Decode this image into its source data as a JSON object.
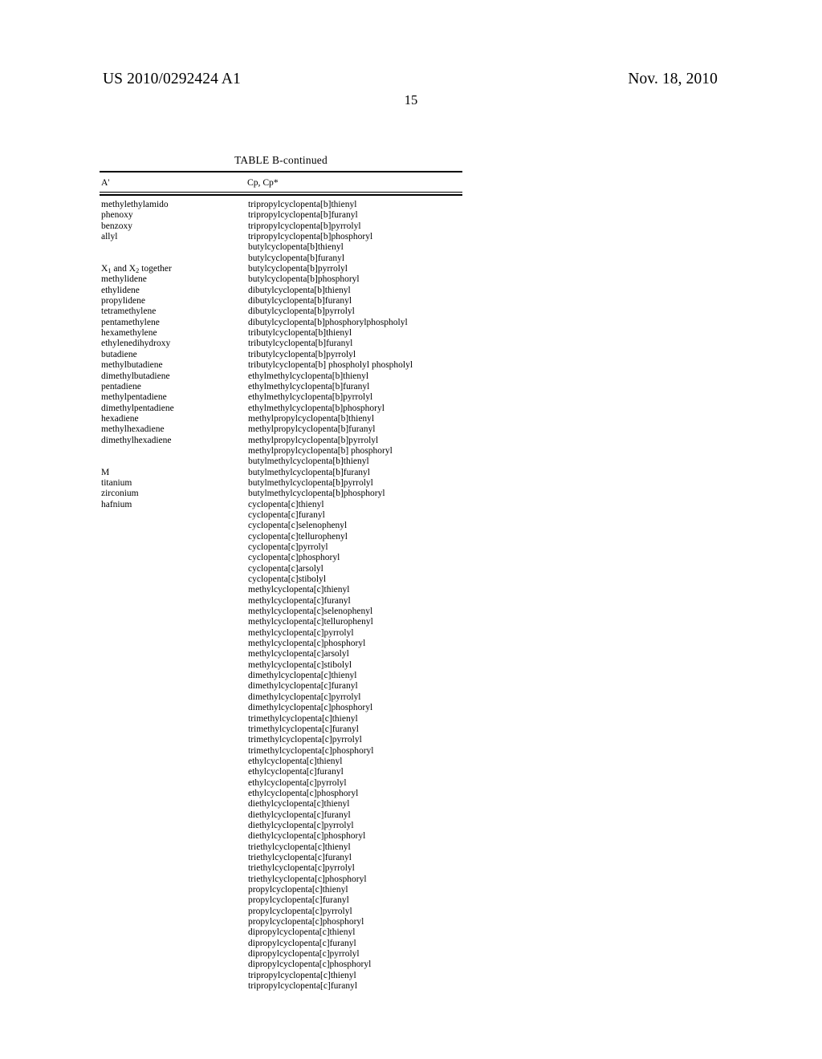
{
  "header": {
    "publication_number": "US 2010/0292424 A1",
    "publication_date": "Nov. 18, 2010",
    "page_number": "15"
  },
  "table": {
    "caption": "TABLE B-continued",
    "columns": [
      "A'",
      "Cp, Cp*"
    ],
    "rows": [
      [
        "methylethylamido",
        "tripropylcyclopenta[b]thienyl"
      ],
      [
        "phenoxy",
        "tripropylcyclopenta[b]furanyl"
      ],
      [
        "benzoxy",
        "tripropylcyclopenta[b]pyrrolyl"
      ],
      [
        "allyl",
        "tripropylcyclopenta[b]phosphoryl"
      ],
      [
        "",
        "butylcyclopenta[b]thienyl"
      ],
      [
        "",
        "butylcyclopenta[b]furanyl"
      ],
      [
        "X and X together",
        "butylcyclopenta[b]pyrrolyl"
      ],
      [
        "methylidene",
        "butylcyclopenta[b]phosphoryl"
      ],
      [
        "ethylidene",
        "dibutylcyclopenta[b]thienyl"
      ],
      [
        "propylidene",
        "dibutylcyclopenta[b]furanyl"
      ],
      [
        "tetramethylene",
        "dibutylcyclopenta[b]pyrrolyl"
      ],
      [
        "pentamethylene",
        "dibutylcyclopenta[b]phosphorylphospholyl"
      ],
      [
        "hexamethylene",
        "tributylcyclopenta[b]thienyl"
      ],
      [
        "ethylenedihydroxy",
        "tributylcyclopenta[b]furanyl"
      ],
      [
        "butadiene",
        "tributylcyclopenta[b]pyrrolyl"
      ],
      [
        "methylbutadiene",
        "tributylcyclopenta[b] phospholyl phospholyl"
      ],
      [
        "dimethylbutadiene",
        "ethylmethylcyclopenta[b]thienyl"
      ],
      [
        "pentadiene",
        "ethylmethylcyclopenta[b]furanyl"
      ],
      [
        "methylpentadiene",
        "ethylmethylcyclopenta[b]pyrrolyl"
      ],
      [
        "dimethylpentadiene",
        "ethylmethylcyclopenta[b]phosphoryl"
      ],
      [
        "hexadiene",
        "methylpropylcyclopenta[b]thienyl"
      ],
      [
        "methylhexadiene",
        "methylpropylcyclopenta[b]furanyl"
      ],
      [
        "dimethylhexadiene",
        "methylpropylcyclopenta[b]pyrrolyl"
      ],
      [
        "",
        "methylpropylcyclopenta[b] phosphoryl"
      ],
      [
        "",
        "butylmethylcyclopenta[b]thienyl"
      ],
      [
        "M",
        "butylmethylcyclopenta[b]furanyl"
      ],
      [
        "titanium",
        "butylmethylcyclopenta[b]pyrrolyl"
      ],
      [
        "zirconium",
        "butylmethylcyclopenta[b]phosphoryl"
      ],
      [
        "hafnium",
        "cyclopenta[c]thienyl"
      ],
      [
        "",
        "cyclopenta[c]furanyl"
      ],
      [
        "",
        "cyclopenta[c]selenophenyl"
      ],
      [
        "",
        "cyclopenta[c]tellurophenyl"
      ],
      [
        "",
        "cyclopenta[c]pyrrolyl"
      ],
      [
        "",
        "cyclopenta[c]phosphoryl"
      ],
      [
        "",
        "cyclopenta[c]arsolyl"
      ],
      [
        "",
        "cyclopenta[c]stibolyl"
      ],
      [
        "",
        "methylcyclopenta[c]thienyl"
      ],
      [
        "",
        "methylcyclopenta[c]furanyl"
      ],
      [
        "",
        "methylcyclopenta[c]selenophenyl"
      ],
      [
        "",
        "methylcyclopenta[c]tellurophenyl"
      ],
      [
        "",
        "methylcyclopenta[c]pyrrolyl"
      ],
      [
        "",
        "methylcyclopenta[c]phosphoryl"
      ],
      [
        "",
        "methylcyclopenta[c]arsolyl"
      ],
      [
        "",
        "methylcyclopenta[c]stibolyl"
      ],
      [
        "",
        "dimethylcyclopenta[c]thienyl"
      ],
      [
        "",
        "dimethylcyclopenta[c]furanyl"
      ],
      [
        "",
        "dimethylcyclopenta[c]pyrrolyl"
      ],
      [
        "",
        "dimethylcyclopenta[c]phosphoryl"
      ],
      [
        "",
        "trimethylcyclopenta[c]thienyl"
      ],
      [
        "",
        "trimethylcyclopenta[c]furanyl"
      ],
      [
        "",
        "trimethylcyclopenta[c]pyrrolyl"
      ],
      [
        "",
        "trimethylcyclopenta[c]phosphoryl"
      ],
      [
        "",
        "ethylcyclopenta[c]thienyl"
      ],
      [
        "",
        "ethylcyclopenta[c]furanyl"
      ],
      [
        "",
        "ethylcyclopenta[c]pyrrolyl"
      ],
      [
        "",
        "ethylcyclopenta[c]phosphoryl"
      ],
      [
        "",
        "diethylcyclopenta[c]thienyl"
      ],
      [
        "",
        "diethylcyclopenta[c]furanyl"
      ],
      [
        "",
        "diethylcyclopenta[c]pyrrolyl"
      ],
      [
        "",
        "diethylcyclopenta[c]phosphoryl"
      ],
      [
        "",
        "triethylcyclopenta[c]thienyl"
      ],
      [
        "",
        "triethylcyclopenta[c]furanyl"
      ],
      [
        "",
        "triethylcyclopenta[c]pyrrolyl"
      ],
      [
        "",
        "triethylcyclopenta[c]phosphoryl"
      ],
      [
        "",
        "propylcyclopenta[c]thienyl"
      ],
      [
        "",
        "propylcyclopenta[c]furanyl"
      ],
      [
        "",
        "propylcyclopenta[c]pyrrolyl"
      ],
      [
        "",
        "propylcyclopenta[c]phosphoryl"
      ],
      [
        "",
        "dipropylcyclopenta[c]thienyl"
      ],
      [
        "",
        "dipropylcyclopenta[c]furanyl"
      ],
      [
        "",
        "dipropylcyclopenta[c]pyrrolyl"
      ],
      [
        "",
        "dipropylcyclopenta[c]phosphoryl"
      ],
      [
        "",
        "tripropylcyclopenta[c]thienyl"
      ],
      [
        "",
        "tripropylcyclopenta[c]furanyl"
      ]
    ]
  }
}
